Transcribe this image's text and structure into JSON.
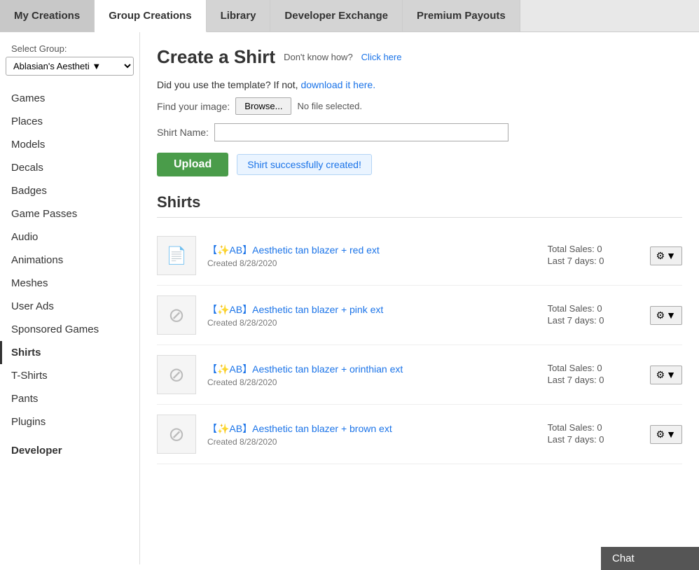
{
  "tabs": [
    {
      "label": "My Creations",
      "active": false
    },
    {
      "label": "Group Creations",
      "active": true
    },
    {
      "label": "Library",
      "active": false
    },
    {
      "label": "Developer Exchange",
      "active": false
    },
    {
      "label": "Premium Payouts",
      "active": false
    }
  ],
  "sidebar": {
    "group_label": "Select Group:",
    "group_value": "Ablasian's Aestheti",
    "group_placeholder": "Ablasian's Aestheti",
    "nav_items": [
      {
        "label": "Games",
        "active": false
      },
      {
        "label": "Places",
        "active": false
      },
      {
        "label": "Models",
        "active": false
      },
      {
        "label": "Decals",
        "active": false
      },
      {
        "label": "Badges",
        "active": false
      },
      {
        "label": "Game Passes",
        "active": false
      },
      {
        "label": "Audio",
        "active": false
      },
      {
        "label": "Animations",
        "active": false
      },
      {
        "label": "Meshes",
        "active": false
      },
      {
        "label": "User Ads",
        "active": false
      },
      {
        "label": "Sponsored Games",
        "active": false
      },
      {
        "label": "Shirts",
        "active": true
      },
      {
        "label": "T-Shirts",
        "active": false
      },
      {
        "label": "Pants",
        "active": false
      },
      {
        "label": "Plugins",
        "active": false
      }
    ],
    "developer_label": "Developer"
  },
  "content": {
    "create_title": "Create a Shirt",
    "help_prefix": "Don't know how?",
    "help_link_text": "Click here",
    "template_text": "Did you use the template? If not,",
    "template_link": "download it here.",
    "find_image_label": "Find your image:",
    "browse_label": "Browse...",
    "no_file_text": "No file selected.",
    "shirt_name_label": "Shirt Name:",
    "shirt_name_value": "",
    "shirt_name_placeholder": "",
    "upload_label": "Upload",
    "success_message": "Shirt successfully created!",
    "section_title": "Shirts",
    "shirts": [
      {
        "name": "【✨AB】Aesthetic tan blazer + red ext",
        "created": "Created  8/28/2020",
        "total_sales": "Total Sales: 0",
        "last_7_days": "Last 7 days: 0",
        "has_image": false,
        "is_first": true
      },
      {
        "name": "【✨AB】Aesthetic tan blazer + pink ext",
        "created": "Created  8/28/2020",
        "total_sales": "Total Sales: 0",
        "last_7_days": "Last 7 days: 0",
        "has_image": false,
        "is_first": false
      },
      {
        "name": "【✨AB】Aesthetic tan blazer + orinthian ext",
        "created": "Created  8/28/2020",
        "total_sales": "Total Sales: 0",
        "last_7_days": "Last 7 days: 0",
        "has_image": false,
        "is_first": false
      },
      {
        "name": "【✨AB】Aesthetic tan blazer + brown ext",
        "created": "Created  8/28/2020",
        "total_sales": "Total Sales: 0",
        "last_7_days": "Last 7 days: 0",
        "has_image": false,
        "is_first": false
      }
    ],
    "chat_label": "Chat"
  }
}
